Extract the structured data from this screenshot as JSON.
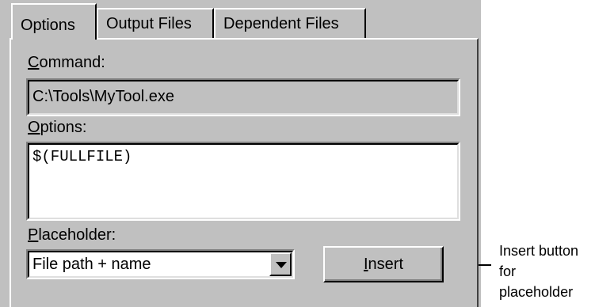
{
  "tabs": [
    {
      "label": "Options"
    },
    {
      "label": "Output Files"
    },
    {
      "label": "Dependent Files"
    }
  ],
  "command": {
    "label_first": "C",
    "label_rest": "ommand:",
    "value": "C:\\Tools\\MyTool.exe"
  },
  "options": {
    "label_first": "O",
    "label_rest": "ptions:",
    "value": "$(FULLFILE)"
  },
  "placeholder": {
    "label_first": "P",
    "label_rest": "laceholder:",
    "selected": "File path + name"
  },
  "insert_button": {
    "label_first": "I",
    "label_rest": "nsert"
  },
  "callout": {
    "line1": "Insert button",
    "line2": "for",
    "line3": "placeholder"
  }
}
